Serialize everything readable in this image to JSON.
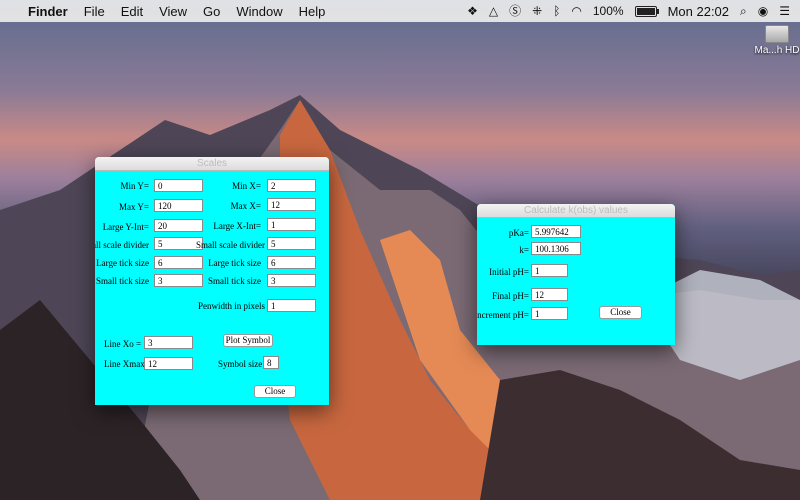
{
  "menubar": {
    "items": [
      "Finder",
      "File",
      "Edit",
      "View",
      "Go",
      "Window",
      "Help"
    ],
    "battery_percent": "100%",
    "battery_level": 1.0,
    "clock": "Mon 22:02",
    "icons": [
      "apple-icon",
      "dropbox-icon",
      "drive-icon",
      "skype-icon",
      "grid-icon",
      "bluetooth-icon",
      "wifi-icon",
      "battery-icon",
      "search-icon",
      "siri-icon",
      "menu-icon"
    ]
  },
  "desktop": {
    "hd_label": "Ma...h HD"
  },
  "scales": {
    "title": "Scales",
    "min_y_label": "Min Y=",
    "min_y": "0",
    "max_y_label": "Max Y=",
    "max_y": "120",
    "large_y_int_label": "Large Y-Int=",
    "large_y_int": "20",
    "small_div_y_label": "Small scale divider",
    "small_div_y": "5",
    "large_tick_y_label": "Large tick size",
    "large_tick_y": "6",
    "small_tick_y_label": "Small tick size",
    "small_tick_y": "3",
    "min_x_label": "Min X=",
    "min_x": "2",
    "max_x_label": "Max X=",
    "max_x": "12",
    "large_x_int_label": "Large X-Int=",
    "large_x_int": "1",
    "small_div_x_label": "Small scale divider",
    "small_div_x": "5",
    "large_tick_x_label": "Large tick size",
    "large_tick_x": "6",
    "small_tick_x_label": "Small tick size",
    "small_tick_x": "3",
    "penwidth_label": "Penwidth in pixels",
    "penwidth": "1",
    "line_xo_label": "Line Xo =",
    "line_xo": "3",
    "line_xmax_label": "Line Xmax =",
    "line_xmax": "12",
    "plot_symbol_label": "Plot Symbol",
    "symbol_size_label": "Symbol size",
    "symbol_size": "8",
    "close_label": "Close"
  },
  "kobs": {
    "title": "Calculate k(obs) values",
    "pka_label": "pKa=",
    "pka": "5.997642",
    "k_label": "k=",
    "k": "100.1306",
    "initial_ph_label": "Initial pH=",
    "initial_ph": "1",
    "final_ph_label": "Final pH=",
    "final_ph": "12",
    "increment_ph_label": "Increment pH=",
    "increment_ph": "1",
    "close_label": "Close"
  }
}
